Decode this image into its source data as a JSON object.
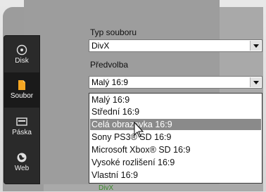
{
  "sidebar": {
    "items": [
      {
        "label": "Disk",
        "icon": "disc-icon"
      },
      {
        "label": "Soubor",
        "icon": "file-icon"
      },
      {
        "label": "Páska",
        "icon": "tape-icon"
      },
      {
        "label": "Web",
        "icon": "globe-icon"
      }
    ],
    "active_index": 1
  },
  "form": {
    "file_type_label": "Typ souboru",
    "file_type_value": "DivX",
    "preset_label": "Předvolba",
    "preset_value": "Malý 16:9"
  },
  "dropdown": {
    "options": [
      "Malý 16:9",
      "Střední 16:9",
      "Celá obrazovka 16:9",
      "Sony PS3® SD 16:9",
      "Microsoft Xbox® SD 16:9",
      "Vysoké rozlišení 16:9",
      "Vlastní 16:9"
    ],
    "highlighted_index": 2
  },
  "peek_text": "DivX",
  "colors": {
    "highlight": "#8a8a8a",
    "sidebar_bg": "#2a2a2a",
    "soubor_icon": "#f5a623"
  }
}
